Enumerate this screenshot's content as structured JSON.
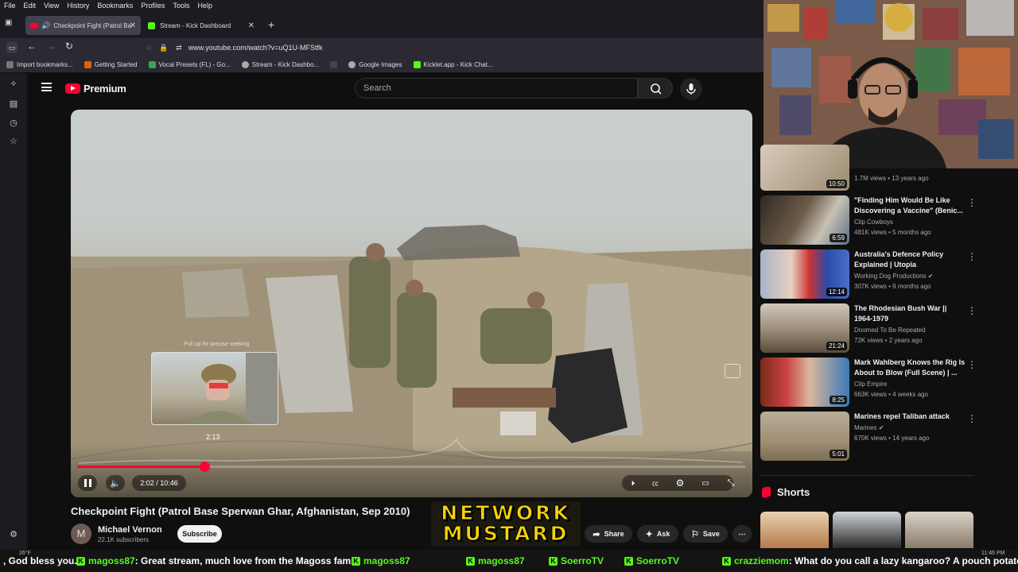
{
  "browser": {
    "menu": [
      "File",
      "Edit",
      "View",
      "History",
      "Bookmarks",
      "Profiles",
      "Tools",
      "Help"
    ],
    "tabs": [
      {
        "label": "Checkpoint Fight (Patrol Ba",
        "active": true
      },
      {
        "label": "Stream - Kick Dashboard",
        "active": false
      }
    ],
    "url": "www.youtube.com/watch?v=uQ1U-MFStfk",
    "bookmarks": [
      "Import bookmarks...",
      "Getting Started",
      "Vocal Presets (FL) - Go...",
      "Stream - Kick Dashbo...",
      "",
      "Google Images",
      "Kicklet.app - Kick Chat..."
    ]
  },
  "youtube": {
    "logo": "Premium",
    "search_placeholder": "Search",
    "player": {
      "preview_hint": "Pull up for precise seeking",
      "preview_time": "2:13",
      "time_display": "2:02 / 10:46",
      "progress_fraction": 0.19
    },
    "video": {
      "title": "Checkpoint Fight (Patrol Base Sperwan Ghar, Afghanistan, Sep 2010)",
      "channel_initial": "M",
      "channel": "Michael Vernon",
      "subscribers": "22.1K subscribers",
      "subscribe_label": "Subscribe",
      "share_label": "Share",
      "ask_label": "Ask",
      "save_label": "Save"
    },
    "recommendations": [
      {
        "title": "",
        "channel": "",
        "meta": "1.7M views • 13 years ago",
        "duration": "10:50",
        "verified": false
      },
      {
        "title": "\"Finding Him Would Be Like Discovering a Vaccine\" (Benic...",
        "channel": "Clip Cowboys",
        "meta": "481K views • 5 months ago",
        "duration": "6:59",
        "verified": false
      },
      {
        "title": "Australia's Defence Policy Explained | Utopia",
        "channel": "Working Dog Productions",
        "meta": "307K views • 9 months ago",
        "duration": "12:14",
        "verified": true
      },
      {
        "title": "The Rhodesian Bush War || 1964-1979",
        "channel": "Doomed To Be Repeated",
        "meta": "72K views • 2 years ago",
        "duration": "21:24",
        "verified": false
      },
      {
        "title": "Mark Wahlberg Knows the Rig Is About to Blow (Full Scene) | ...",
        "channel": "Clip Empire",
        "meta": "663K views • 4 weeks ago",
        "duration": "8:25",
        "verified": false
      },
      {
        "title": "Marines repel Taliban attack",
        "channel": "Marines",
        "meta": "670K views • 14 years ago",
        "duration": "5:01",
        "verified": true
      }
    ],
    "shorts_label": "Shorts"
  },
  "overlay": {
    "logo_line1": "NETWORK",
    "logo_line2": "MUSTARD"
  },
  "ticker": {
    "items": [
      {
        "user": "",
        "text": ", God bless you."
      },
      {
        "user": "magoss87",
        "text": ": Great stream, much love from the Magoss fam!"
      },
      {
        "user": "magoss87",
        "text": ""
      },
      {
        "user": "magoss87",
        "text": ""
      },
      {
        "user": "SoerroTV",
        "text": ""
      },
      {
        "user": "SoerroTV",
        "text": ""
      },
      {
        "user": "crazziemom",
        "text": ": What do you call a lazy kangaroo? A pouch potato"
      }
    ],
    "clock": "11:46 PM",
    "weather": "26°F"
  },
  "colors": {
    "accent": "#ff0033",
    "kick": "#53fc18",
    "mustard": "#f5d20a"
  }
}
